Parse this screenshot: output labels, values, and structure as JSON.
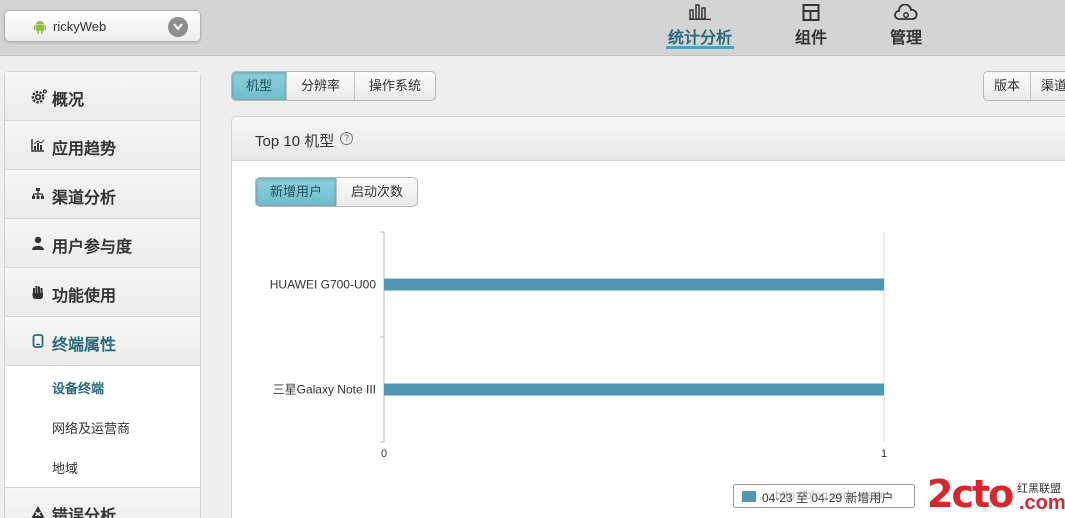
{
  "app_select": {
    "name": "rickyWeb"
  },
  "top_nav": [
    {
      "label": "统计分析",
      "icon": "bar-chart-icon",
      "active": true
    },
    {
      "label": "组件",
      "icon": "components-icon",
      "active": false
    },
    {
      "label": "管理",
      "icon": "cloud-manage-icon",
      "active": false
    }
  ],
  "sidebar": {
    "items": [
      {
        "label": "概况",
        "icon": "gear-icon"
      },
      {
        "label": "应用趋势",
        "icon": "trend-chart-icon"
      },
      {
        "label": "渠道分析",
        "icon": "hierarchy-icon"
      },
      {
        "label": "用户参与度",
        "icon": "user-icon"
      },
      {
        "label": "功能使用",
        "icon": "hand-icon"
      },
      {
        "label": "终端属性",
        "icon": "phone-icon"
      },
      {
        "label": "错误分析",
        "icon": "warning-icon"
      }
    ],
    "subitems": [
      "设备终端",
      "网络及运营商",
      "地域"
    ]
  },
  "tabs_left": [
    "机型",
    "分辨率",
    "操作系统"
  ],
  "tabs_right": [
    "版本",
    "渠道"
  ],
  "panel": {
    "title": "Top 10 机型",
    "help": "?",
    "metric_tabs": [
      "新增用户",
      "启动次数"
    ]
  },
  "legend": {
    "label": "04-23 至 04-29 新增用户"
  },
  "watermark": {
    "big": "2cto",
    "small": "红黑联盟",
    "com": ".com",
    "url": "http://blog.csdn.net/r"
  },
  "colors": {
    "accent": "#4aa3b8",
    "bar": "#4f97b3",
    "active_tab": "#6dbccb",
    "watermark_red": "#d9262c"
  },
  "chart_data": {
    "type": "bar",
    "orientation": "horizontal",
    "categories": [
      "HUAWEI G700-U00",
      "三星Galaxy Note III"
    ],
    "series": [
      {
        "name": "04-23 至 04-29 新增用户",
        "values": [
          1,
          1
        ]
      }
    ],
    "xlim": [
      0,
      1
    ],
    "xticks": [
      "0",
      "1"
    ],
    "grid": true,
    "legend_position": "bottom-right"
  }
}
